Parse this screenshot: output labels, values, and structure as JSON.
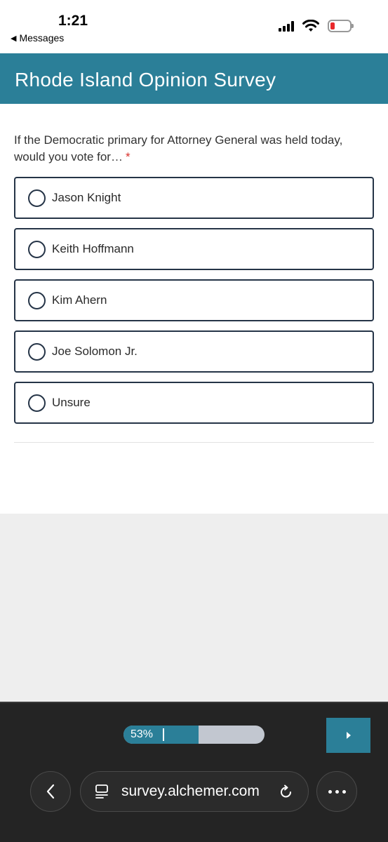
{
  "status_bar": {
    "time": "1:21",
    "back_label": "Messages",
    "battery_color": "#e8292b"
  },
  "header": {
    "title": "Rhode Island Opinion Survey",
    "color": "#2b7f98"
  },
  "question": {
    "text": "If the Democratic primary for Attorney General was held today, would you vote for…",
    "required_mark": "*",
    "options": [
      {
        "label": "Jason Knight"
      },
      {
        "label": "Keith Hoffmann"
      },
      {
        "label": "Kim Ahern"
      },
      {
        "label": "Joe Solomon Jr."
      },
      {
        "label": "Unsure"
      }
    ]
  },
  "progress": {
    "label": "53%",
    "value": 0.53
  },
  "browser": {
    "url": "survey.alchemer.com",
    "icons": [
      "chevron-left-icon",
      "tabs-icon",
      "reload-icon",
      "more-icon",
      "next-arrow-icon"
    ]
  }
}
